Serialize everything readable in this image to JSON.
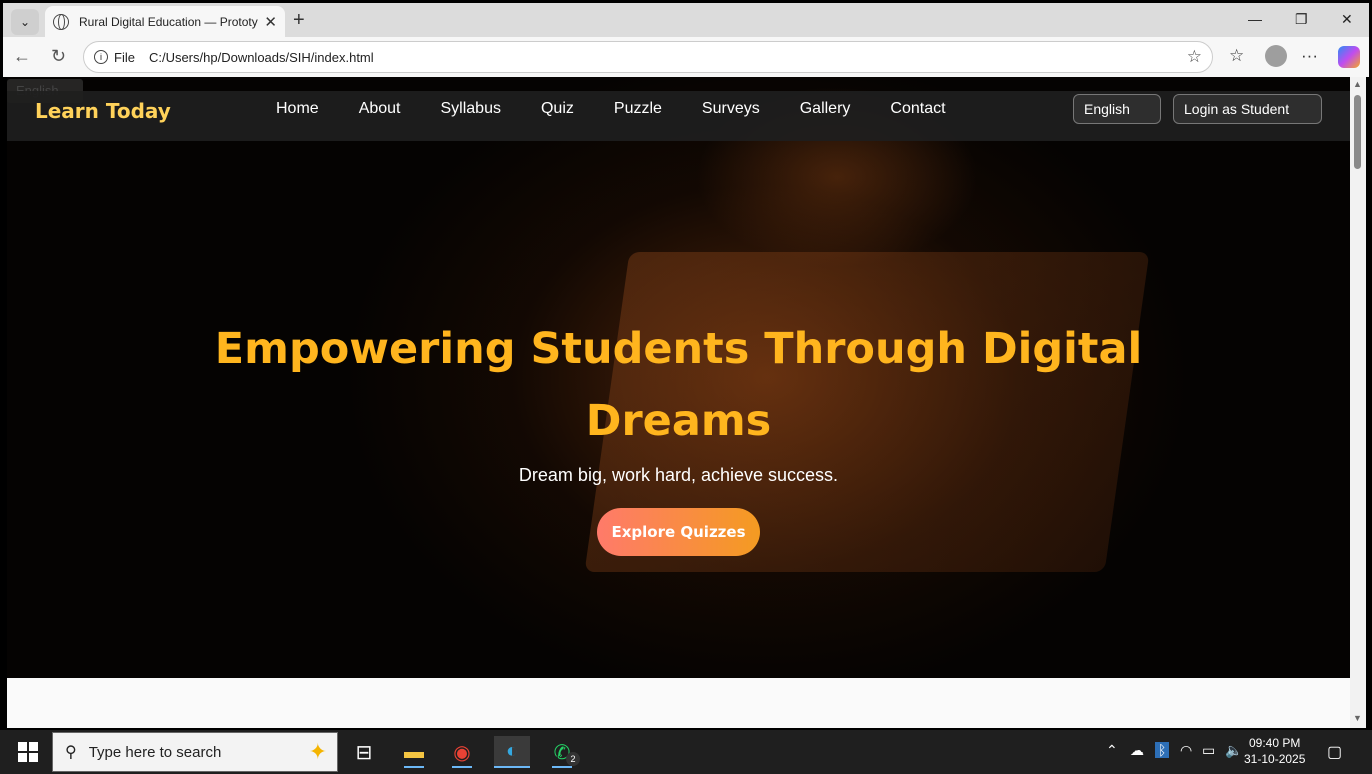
{
  "browser": {
    "tab_title": "Rural Digital Education — Prototy",
    "address_scheme": "File",
    "address_url": "C:/Users/hp/Downloads/SIH/index.html"
  },
  "page": {
    "language_select": "English",
    "brand": "Learn Today",
    "nav_links": [
      "Home",
      "About",
      "Syllabus",
      "Quiz",
      "Puzzle",
      "Surveys",
      "Gallery",
      "Contact"
    ],
    "lang_button": "English",
    "login_button": "Login as Student",
    "hero_title": "Empowering Students Through Digital Dreams",
    "hero_subtitle": "Dream big, work hard, achieve success.",
    "cta_button": "Explore Quizzes"
  },
  "taskbar": {
    "search_placeholder": "Type here to search",
    "whatsapp_badge": "2",
    "time": "09:40 PM",
    "date": "31-10-2025"
  },
  "colors": {
    "brand": "#ffd25a",
    "hero_title": "#ffb51e",
    "cta_start": "#ff7a6a",
    "cta_end": "#f49b21"
  }
}
